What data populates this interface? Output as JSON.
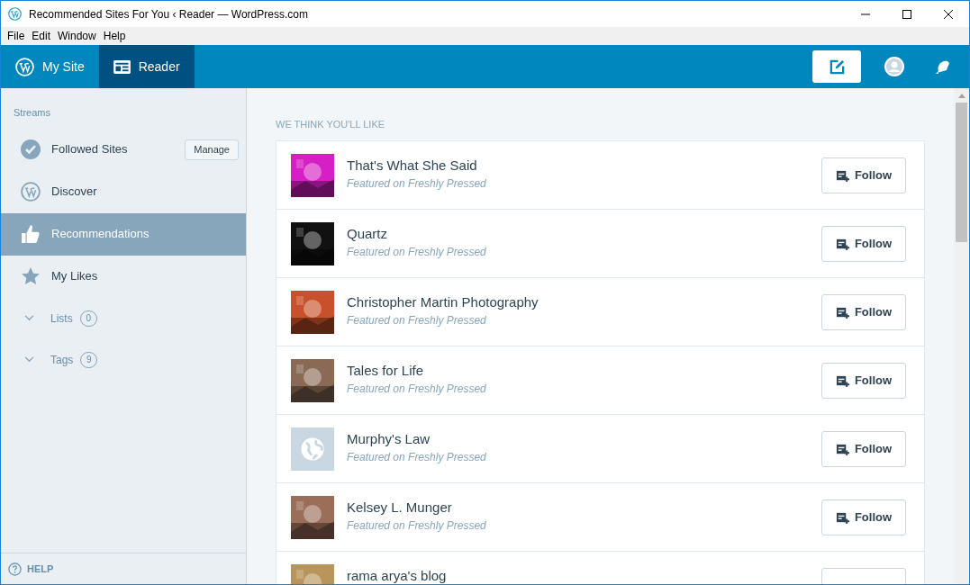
{
  "window": {
    "title": "Recommended Sites For You ‹ Reader — WordPress.com"
  },
  "menu": [
    "File",
    "Edit",
    "Window",
    "Help"
  ],
  "nav_tabs": [
    {
      "label": "My Site",
      "selected": false
    },
    {
      "label": "Reader",
      "selected": true
    }
  ],
  "toolbar": {
    "compose_selected": true
  },
  "sidebar": {
    "heading": "Streams",
    "manage_button": "Manage",
    "items": [
      {
        "kind": "stream",
        "label": "Followed Sites",
        "selected": false
      },
      {
        "kind": "stream",
        "label": "Discover",
        "selected": false
      },
      {
        "kind": "stream",
        "label": "Recommendations",
        "selected": true
      },
      {
        "kind": "stream",
        "label": "My Likes",
        "selected": false
      },
      {
        "kind": "collapsible",
        "label": "Lists",
        "count": "0",
        "expanded": false
      },
      {
        "kind": "collapsible",
        "label": "Tags",
        "count": "9",
        "expanded": false
      }
    ],
    "help": "HELP"
  },
  "main": {
    "heading": "WE THINK YOU'LL LIKE",
    "sites": [
      {
        "name": "That's What She Said",
        "subtitle": "Featured on Freshly Pressed",
        "kind": "picture",
        "button": "Follow"
      },
      {
        "name": "Quartz",
        "subtitle": "Featured on Freshly Pressed",
        "kind": "picture",
        "button": "Follow"
      },
      {
        "name": "Christopher Martin Photography",
        "subtitle": "Featured on Freshly Pressed",
        "kind": "picture",
        "button": "Follow"
      },
      {
        "name": "Tales for Life",
        "subtitle": "Featured on Freshly Pressed",
        "kind": "picture",
        "button": "Follow"
      },
      {
        "name": "Murphy's Law",
        "subtitle": "Featured on Freshly Pressed",
        "kind": "placeholder",
        "button": "Follow"
      },
      {
        "name": "Kelsey L. Munger",
        "subtitle": "Featured on Freshly Pressed",
        "kind": "picture",
        "button": "Follow"
      },
      {
        "name": "rama arya's blog",
        "kind": "picture"
      }
    ]
  }
}
